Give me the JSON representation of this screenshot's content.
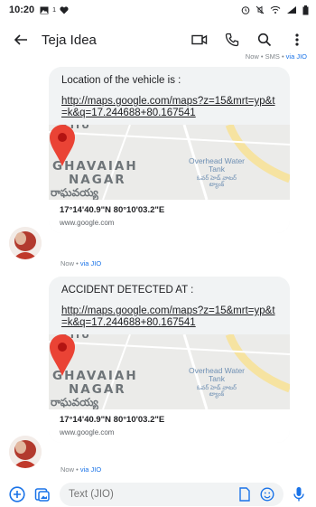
{
  "status_bar": {
    "time": "10:20",
    "icons": [
      "gallery-icon",
      "data-speed-icon",
      "heart-icon",
      "alarm-icon",
      "mute-icon",
      "wifi-icon",
      "signal-icon",
      "battery-icon"
    ],
    "speed_text": "1"
  },
  "app_bar": {
    "contact_name": "Teja Idea",
    "icons": [
      "back-arrow-icon",
      "video-call-icon",
      "phone-icon",
      "search-icon",
      "more-vert-icon"
    ]
  },
  "top_meta": {
    "time": "Now",
    "sep": " • SMS • ",
    "via": "via JIO"
  },
  "messages": [
    {
      "heading": "Location of the vehicle is :",
      "link": "http://maps.google.com/maps?z=15&mrt=yp&t=k&q=17.244688+80.167541",
      "map": {
        "big_text": "GHAVAIAH",
        "big_text2": "NAGAR",
        "telugu": "రాఘవయ్య",
        "small": "Overhead Water Tank",
        "small_te": "ఓవర్ హెడ్ వాటర్ ట్యాంక్"
      },
      "preview_title": "17°14'40.9\"N 80°10'03.2\"E",
      "preview_domain": "www.google.com",
      "meta_time": "Now",
      "meta_sep": " • ",
      "meta_via": "via JIO"
    },
    {
      "heading": "ACCIDENT DETECTED AT :",
      "link": "http://maps.google.com/maps?z=15&mrt=yp&t=k&q=17.244688+80.167541",
      "map": {
        "big_text": "GHAVAIAH",
        "big_text2": "NAGAR",
        "telugu": "రాఘవయ్య",
        "small": "Overhead Water Tank",
        "small_te": "ఓవర్ హెడ్ వాటర్ ట్యాంక్"
      },
      "preview_title": "17°14'40.9\"N 80°10'03.2\"E",
      "preview_domain": "www.google.com",
      "meta_time": "Now",
      "meta_sep": " • ",
      "meta_via": "via JIO"
    }
  ],
  "compose": {
    "placeholder": "Text (JIO)",
    "icons": [
      "add-icon",
      "gallery-sticker-icon",
      "sim-icon",
      "emoji-icon",
      "mic-icon"
    ],
    "sim_number": "1"
  },
  "colors": {
    "accent": "#1a73e8",
    "pin": "#ea4335",
    "bubble": "#f1f3f4",
    "road": "#f7e7a8"
  }
}
